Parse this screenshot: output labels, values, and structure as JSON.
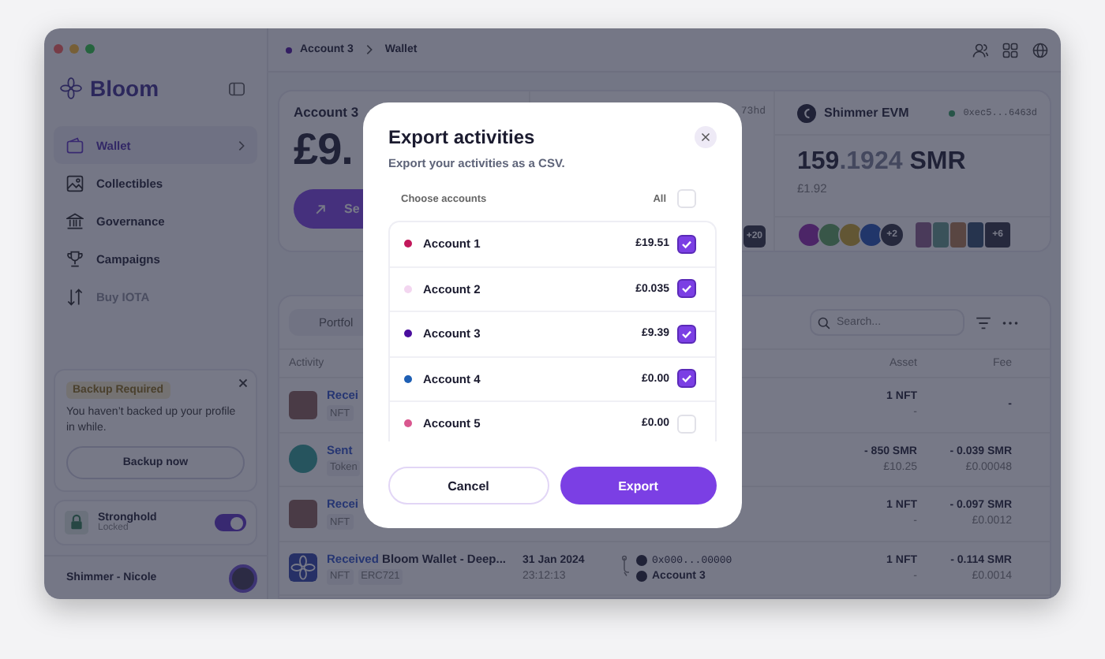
{
  "sidebar": {
    "brand": "Bloom",
    "items": [
      {
        "kind": "wallet",
        "label": "Wallet",
        "selected": true,
        "disabled": false
      },
      {
        "kind": "image",
        "label": "Collectibles",
        "selected": false,
        "disabled": false
      },
      {
        "kind": "bank",
        "label": "Governance",
        "selected": false,
        "disabled": false
      },
      {
        "kind": "trophy",
        "label": "Campaigns",
        "selected": false,
        "disabled": false
      },
      {
        "kind": "arrows",
        "label": "Buy IOTA",
        "selected": false,
        "disabled": true
      }
    ],
    "backup": {
      "badge": "Backup Required",
      "message": "You haven’t backed up your profile in while.",
      "button": "Backup now"
    },
    "stronghold": {
      "title": "Stronghold",
      "status": "Locked",
      "on": true
    },
    "profile": {
      "name": "Shimmer - Nicole"
    }
  },
  "breadcrumb": {
    "account": "Account 3",
    "page": "Wallet"
  },
  "balance_card": {
    "account": "Account 3",
    "amount": "£9.",
    "send_button": "Se"
  },
  "network_card": {
    "address": "73hd",
    "nfts_more": "+20"
  },
  "evm_card": {
    "network": "Shimmer EVM",
    "address": "0xec5...6463d",
    "balance_whole": "159",
    "balance_fraction": ".1924",
    "unit": "SMR",
    "fiat": "£1.92",
    "tokens_more": "+2",
    "nfts_more": "+6"
  },
  "activity": {
    "tab": "Portfol",
    "search": {
      "placeholder": "Search..."
    },
    "columns": [
      "Activity",
      "Asset",
      "Fee"
    ],
    "rows": [
      {
        "kind": "nft",
        "action": "Recei",
        "tags": [
          "NFT"
        ],
        "asset": "1 NFT",
        "asset_fiat": "-",
        "fee": "-"
      },
      {
        "kind": "token",
        "action": "Sent",
        "tags": [
          "Token"
        ],
        "asset": "- 850 SMR",
        "asset_fiat": "£10.25",
        "fee": "- 0.039 SMR",
        "fee_fiat": "£0.00048"
      },
      {
        "kind": "nft",
        "action": "Recei",
        "tags": [
          "NFT"
        ],
        "asset": "1 NFT",
        "asset_fiat": "-",
        "fee": "- 0.097 SMR",
        "fee_fiat": "£0.0012"
      },
      {
        "kind": "bloom",
        "action": "Received",
        "title": "Bloom Wallet - Deep...",
        "tags": [
          "NFT",
          "ERC721"
        ],
        "date": "31 Jan 2024",
        "time": "23:12:13",
        "from": "0x000...00000",
        "to": "Account 3",
        "asset": "1 NFT",
        "asset_fiat": "-",
        "fee": "- 0.114 SMR",
        "fee_fiat": "£0.0014"
      }
    ]
  },
  "export_modal": {
    "title": "Export activities",
    "subtitle": "Export your activities as a CSV.",
    "choose_label": "Choose accounts",
    "all_label": "All",
    "all_checked": false,
    "accounts": [
      {
        "name": "Account 1",
        "balance": "£19.51",
        "color": "#c2185b",
        "checked": true
      },
      {
        "name": "Account 2",
        "balance": "£0.035",
        "color": "#f3d6f0",
        "checked": true
      },
      {
        "name": "Account 3",
        "balance": "£9.39",
        "color": "#4a0e9e",
        "checked": true
      },
      {
        "name": "Account 4",
        "balance": "£0.00",
        "color": "#1e5fb4",
        "checked": true
      },
      {
        "name": "Account 5",
        "balance": "£0.00",
        "color": "#d9578f",
        "checked": false
      }
    ],
    "cancel": "Cancel",
    "export": "Export"
  }
}
